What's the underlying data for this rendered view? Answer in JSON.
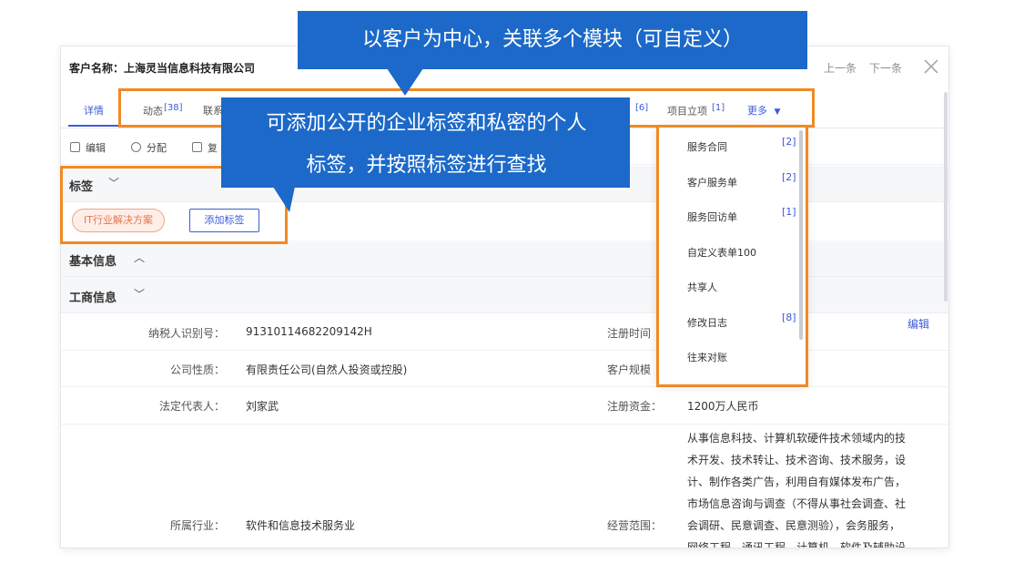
{
  "header": {
    "customer_title": "客户名称：上海灵当信息科技有限公司",
    "prev": "上一条",
    "next": "下一条"
  },
  "tabs": [
    {
      "label": "详情",
      "count": ""
    },
    {
      "label": "动态",
      "count": "[38]"
    },
    {
      "label": "联系",
      "count": ""
    },
    {
      "label": "",
      "count": "[6]"
    },
    {
      "label": "项目立项",
      "count": "[1]"
    },
    {
      "label": "更多",
      "count": ""
    }
  ],
  "toolbar": {
    "edit": "编辑",
    "assign": "分配",
    "copy": "复"
  },
  "tags": {
    "section_label": "标签",
    "chip": "IT行业解决方案",
    "add_button": "添加标签"
  },
  "sections": {
    "basic_info": "基本信息",
    "business_info": "工商信息"
  },
  "info": {
    "tax_id_label": "纳税人识别号：",
    "tax_id": "91310114682209142H",
    "reg_time_label": "注册时间",
    "company_type_label": "公司性质：",
    "company_type": "有限责任公司(自然人投资或控股)",
    "scale_label": "客户规模",
    "legal_rep_label": "法定代表人：",
    "legal_rep": "刘家武",
    "reg_capital_label": "注册资金：",
    "reg_capital": "1200万人民币",
    "industry_label": "所属行业：",
    "industry": "软件和信息技术服务业",
    "scope_label": "经营范围：",
    "scope_lines": [
      "从事信息科技、计算机软硬件技术领域内的技",
      "术开发、技术转让、技术咨询、技术服务，设",
      "计、制作各类广告，利用自有媒体发布广告，",
      "市场信息咨询与调查（不得从事社会调查、社",
      "会调研、民意调查、民意测验），会务服务，",
      "网络工程、通讯工程、计算机、软件及辅助设"
    ],
    "edit_link": "编辑"
  },
  "more_menu": [
    {
      "label": "服务合同",
      "count": "[2]"
    },
    {
      "label": "客户服务单",
      "count": "[2]"
    },
    {
      "label": "服务回访单",
      "count": "[1]"
    },
    {
      "label": "自定义表单100",
      "count": ""
    },
    {
      "label": "共享人",
      "count": ""
    },
    {
      "label": "修改日志",
      "count": "[8]"
    },
    {
      "label": "往来对账",
      "count": ""
    }
  ],
  "callouts": {
    "top": "以客户为中心，关联多个模块（可自定义）",
    "left_line1": "可添加公开的企业标签和私密的个人",
    "left_line2": "标签，并按照标签进行查找"
  },
  "colors": {
    "accent": "#3d5bd9",
    "callout": "#1c69c9",
    "highlight": "#f08a24",
    "tag": "#e8774c"
  }
}
